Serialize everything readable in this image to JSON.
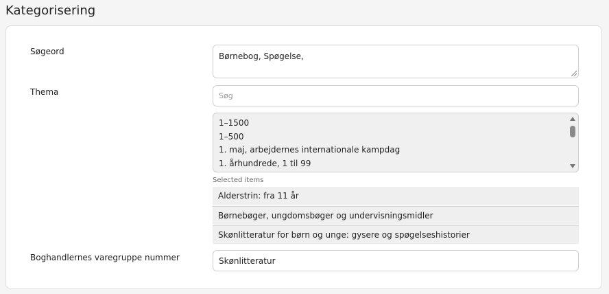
{
  "section": {
    "title": "Kategorisering"
  },
  "fields": {
    "sogeord": {
      "label": "Søgeord",
      "value": "Børnebog, Spøgelse,"
    },
    "thema": {
      "label": "Thema",
      "search_placeholder": "Søg",
      "options": [
        "1–1500",
        "1–500",
        "1. maj, arbejdernes internationale kampdag",
        "1. århundrede, 1 til 99"
      ],
      "selected_caption": "Selected items",
      "selected": [
        "Alderstrin: fra 11 år",
        "Børnebøger, ungdomsbøger og undervisningsmidler",
        "Skønlitteratur for børn og unge: gysere og spøgelseshistorier"
      ]
    },
    "varegruppe": {
      "label": "Boghandlernes varegruppe nummer",
      "value": "Skønlitteratur"
    }
  }
}
